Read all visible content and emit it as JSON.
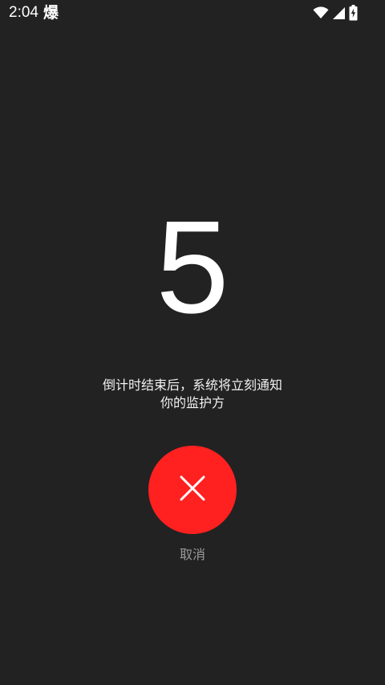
{
  "status_bar": {
    "time": "2:04",
    "app_indicator": "爆",
    "icons": [
      "wifi-icon",
      "cellular-signal-icon",
      "battery-charging-icon"
    ]
  },
  "countdown": {
    "value": "5"
  },
  "notice": {
    "line1": "倒计时结束后，系统将立刻通知",
    "line2": "你的监护方"
  },
  "cancel": {
    "label": "取消",
    "icon": "close-icon",
    "color": "#ff2020"
  }
}
